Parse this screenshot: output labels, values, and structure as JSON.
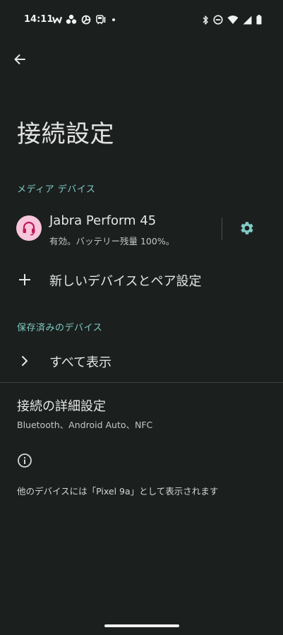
{
  "status_bar": {
    "time": "14:11",
    "left_icons": [
      "w-app-icon",
      "fan-icon",
      "pinwheel-icon",
      "train-icon",
      "dot-icon"
    ],
    "right_icons": [
      "bluetooth-icon",
      "do-not-disturb-icon",
      "wifi-icon",
      "signal-icon",
      "battery-icon"
    ]
  },
  "header": {
    "back_icon": "arrow-back-icon",
    "title": "接続設定"
  },
  "media_devices": {
    "section_label": "メディア デバイス",
    "device": {
      "icon": "headset-icon",
      "name": "Jabra Perform 45",
      "status": "有効。バッテリー残量 100%。",
      "settings_icon": "gear-icon"
    }
  },
  "pair_new": {
    "icon": "plus-icon",
    "label": "新しいデバイスとペア設定"
  },
  "saved_devices": {
    "section_label": "保存済みのデバイス",
    "see_all": {
      "icon": "chevron-right-icon",
      "label": "すべて表示"
    }
  },
  "advanced": {
    "title": "接続の詳細設定",
    "subtitle": "Bluetooth、Android Auto、NFC"
  },
  "footer": {
    "info_icon": "info-icon",
    "text": "他のデバイスには「Pixel 9a」として表示されます"
  },
  "colors": {
    "background": "#1b1f1e",
    "accent": "#80cbc4",
    "avatar_bg": "#f8c6da",
    "avatar_fg": "#c2185b"
  }
}
